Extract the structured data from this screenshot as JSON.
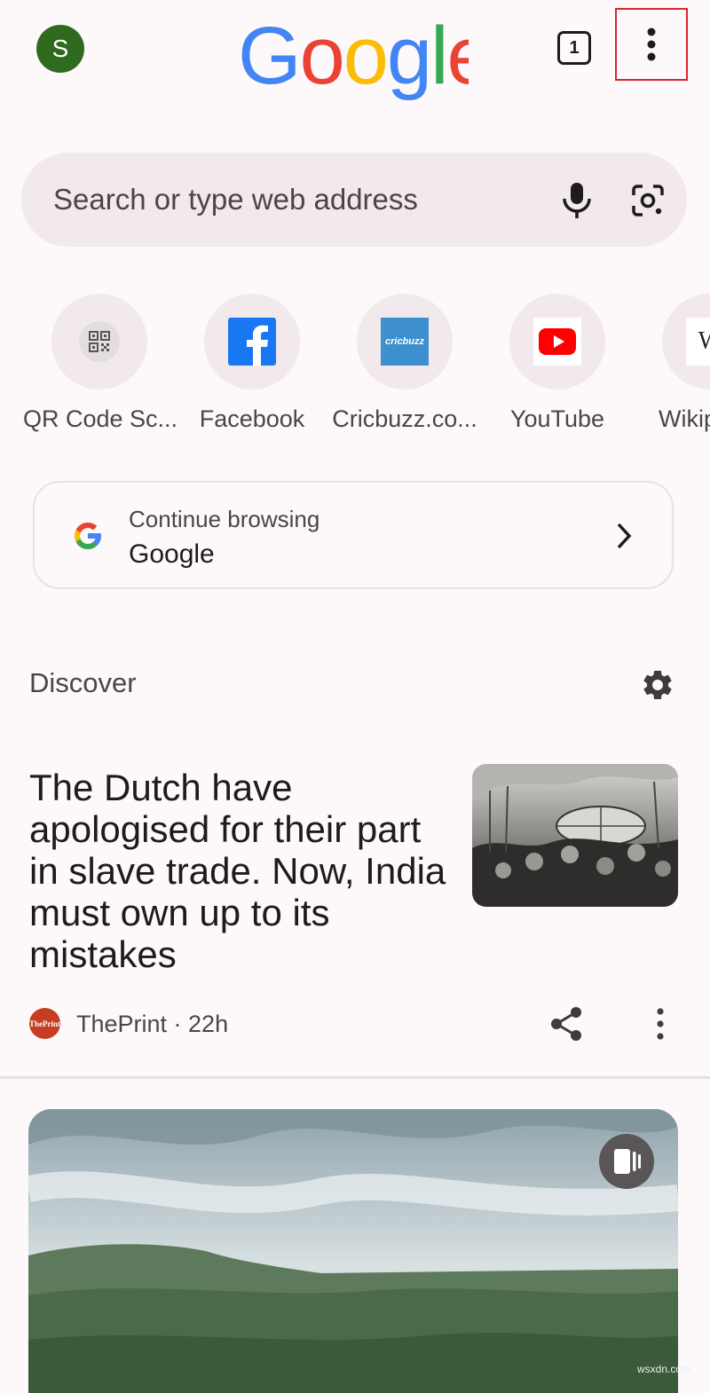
{
  "header": {
    "avatar_letter": "S",
    "logo_text": "Google",
    "tab_count": "1"
  },
  "search": {
    "placeholder": "Search or type web address"
  },
  "shortcuts": [
    {
      "label": "QR Code Sc...",
      "icon": "qr-code-icon"
    },
    {
      "label": "Facebook",
      "icon": "facebook-icon"
    },
    {
      "label": "Cricbuzz.co...",
      "icon": "cricbuzz-icon",
      "icon_text": "cricbuzz"
    },
    {
      "label": "YouTube",
      "icon": "youtube-icon"
    },
    {
      "label": "Wikip",
      "icon": "wikipedia-icon",
      "icon_text": "W"
    }
  ],
  "continue_browsing": {
    "subtitle": "Continue browsing",
    "title": "Google"
  },
  "discover": {
    "title": "Discover",
    "articles": [
      {
        "headline": "The Dutch have apologised for their part in slave trade. Now, India must own up to its mistakes",
        "publisher_logo_text": "ThePrint",
        "meta": "ThePrint · 22h"
      }
    ]
  },
  "watermark": "wsxdn.com",
  "colors": {
    "background": "#fdf8fa",
    "chip": "#f1e9ec",
    "google_blue": "#4285F4",
    "google_red": "#EA4335",
    "google_yellow": "#FBBC05",
    "google_green": "#34A853",
    "highlight_box": "#d9262c"
  }
}
